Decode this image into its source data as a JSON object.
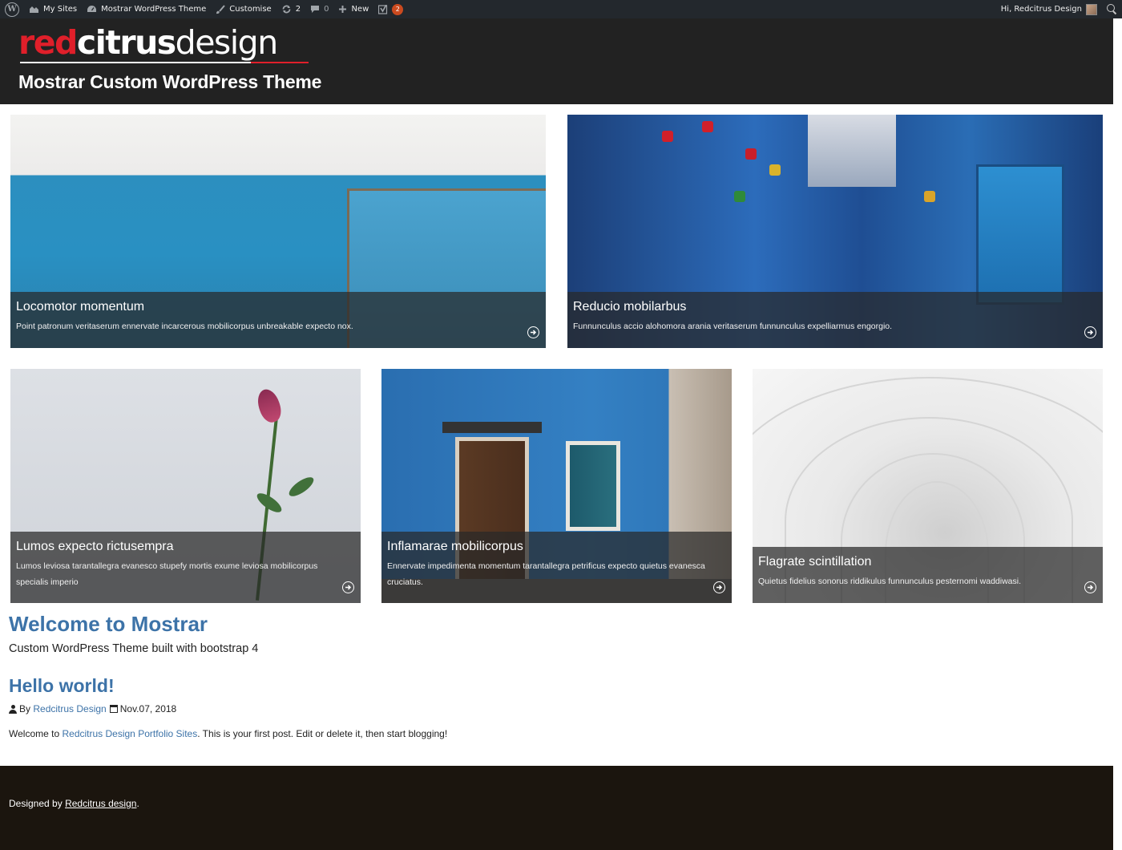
{
  "adminbar": {
    "my_sites": "My Sites",
    "site_name": "Mostrar WordPress Theme",
    "customise": "Customise",
    "updates_count": "2",
    "comments_count": "0",
    "new_label": "New",
    "yoast_badge": "2",
    "greeting": "Hi, Redcitrus Design"
  },
  "header": {
    "logo_red": "red",
    "logo_bold": "citrus",
    "logo_light": "design",
    "site_title": "Mostrar Custom WordPress Theme"
  },
  "cards": [
    {
      "title": "Locomotor momentum",
      "excerpt": "Point patronum veritaserum ennervate incarcerous mobilicorpus unbreakable expecto nox."
    },
    {
      "title": "Reducio mobilarbus",
      "excerpt": "Funnunculus accio alohomora arania veritaserum funnunculus expelliarmus engorgio."
    },
    {
      "title": "Lumos expecto rictusempra",
      "excerpt": "Lumos leviosa tarantallegra evanesco stupefy mortis exume leviosa mobilicorpus specialis imperio"
    },
    {
      "title": "Inflamarae mobilicorpus",
      "excerpt": "Ennervate impedimenta momentum tarantallegra petrificus expecto quietus evanesca cruciatus."
    },
    {
      "title": "Flagrate scintillation",
      "excerpt": "Quietus fidelius sonorus riddikulus funnunculus pesternomi waddiwasi."
    }
  ],
  "main": {
    "welcome_title": "Welcome to Mostrar",
    "welcome_sub": "Custom WordPress Theme built with bootstrap 4",
    "post_title": "Hello world!",
    "post_by": "By",
    "post_author": "Redcitrus Design",
    "post_date": "Nov.07, 2018",
    "body_prefix": "Welcome to",
    "body_link": "Redcitrus Design Portfolio Sites",
    "body_suffix": ". This is your first post. Edit or delete it, then start blogging!"
  },
  "footer": {
    "prefix": "Designed by",
    "link": "Redcitrus design",
    "suffix": "."
  },
  "colors": {
    "accent": "#3d73a8",
    "brand_red": "#e01f2a",
    "header_bg": "#222222",
    "adminbar_bg": "#23282d",
    "footer_bg": "#1b150e"
  },
  "icons": [
    "wordpress-logo-icon",
    "my-sites-icon",
    "dashboard-icon",
    "paintbrush-icon",
    "updates-icon",
    "comment-icon",
    "plus-icon",
    "yoast-icon",
    "avatar",
    "search-icon",
    "arrow-circle-right-icon",
    "user-icon",
    "calendar-icon"
  ]
}
